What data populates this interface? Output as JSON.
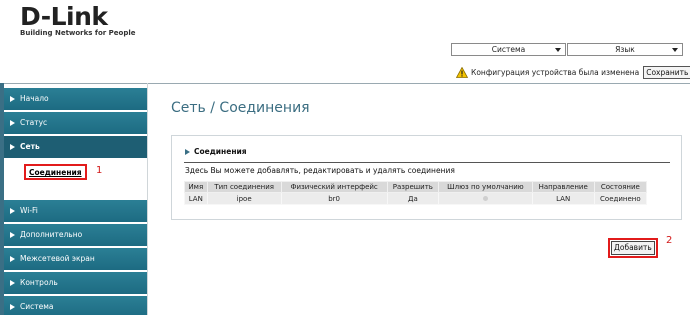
{
  "logo": {
    "brand": "D-Link",
    "tagline": "Building Networks for People"
  },
  "top_bar": {
    "system_select": "Система",
    "language_select": "Язык"
  },
  "notice": {
    "text": "Конфигурация устройства была изменена",
    "save_label": "Сохранить"
  },
  "sidebar": {
    "items": [
      {
        "label": "Начало"
      },
      {
        "label": "Статус"
      },
      {
        "label": "Сеть"
      },
      {
        "label": "Wi-Fi"
      },
      {
        "label": "Дополнительно"
      },
      {
        "label": "Межсетевой экран"
      },
      {
        "label": "Контроль"
      },
      {
        "label": "Система"
      }
    ],
    "subitem": {
      "label": "Соединения"
    }
  },
  "annotations": {
    "marker_1": "1",
    "marker_2": "2"
  },
  "page": {
    "title": "Сеть  / Соединения"
  },
  "panel": {
    "title": "Соединения",
    "description": "Здесь Вы можете добавлять, редактировать и удалять соединения",
    "columns": [
      "Имя",
      "Тип соединения",
      "Физический интерфейс",
      "Разрешить",
      "Шлюз по умолчанию",
      "Направление",
      "Состояние"
    ],
    "rows": [
      [
        "LAN",
        "ipoe",
        "br0",
        "Да",
        "",
        "LAN",
        "Соединено"
      ]
    ]
  },
  "add_button": {
    "label": "Добавить"
  },
  "colors": {
    "sidebar_bg": "#1d6b82",
    "title_color": "#3c6e82",
    "highlight_red": "#e21b1b"
  }
}
